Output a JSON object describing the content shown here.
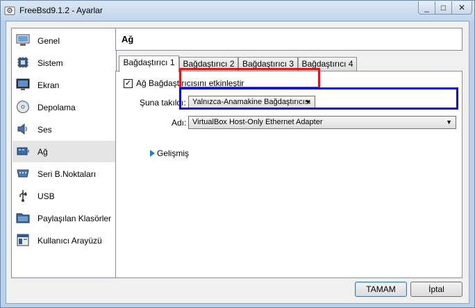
{
  "window": {
    "title": "FreeBsd9.1.2 - Ayarlar",
    "minimize": "_",
    "maximize": "□",
    "close": "✕"
  },
  "sidebar": {
    "items": [
      {
        "label": "Genel",
        "icon": "monitor-icon"
      },
      {
        "label": "Sistem",
        "icon": "chip-icon"
      },
      {
        "label": "Ekran",
        "icon": "display-icon"
      },
      {
        "label": "Depolama",
        "icon": "disk-icon"
      },
      {
        "label": "Ses",
        "icon": "speaker-icon"
      },
      {
        "label": "Ağ",
        "icon": "network-icon",
        "selected": true
      },
      {
        "label": "Seri B.Noktaları",
        "icon": "serial-port-icon"
      },
      {
        "label": "USB",
        "icon": "usb-icon"
      },
      {
        "label": "Paylaşılan Klasörler",
        "icon": "shared-folder-icon"
      },
      {
        "label": "Kullanıcı Arayüzü",
        "icon": "user-interface-icon"
      }
    ]
  },
  "header": {
    "title": "Ağ"
  },
  "tabs": [
    {
      "label": "Bağdaştırıcı 1",
      "active": true
    },
    {
      "label": "Bağdaştırıcı 2"
    },
    {
      "label": "Bağdaştırıcı 3"
    },
    {
      "label": "Bağdaştırıcı 4"
    }
  ],
  "adapter": {
    "enable_label": "Ağ Bağdaştırıcısını etkinleştir",
    "enable_checked": true,
    "check_glyph": "✓",
    "attached_label": "Şuna takıldı:",
    "attached_value": "Yalnızca-Anamakine Bağdaştırıcısı",
    "name_label": "Adı:",
    "name_value": "VirtualBox Host-Only Ethernet Adapter",
    "advanced_label": "Gelişmiş",
    "dropdown_arrow": "▼"
  },
  "buttons": {
    "ok": "TAMAM",
    "cancel": "İptal"
  },
  "colors": {
    "highlight_red": "#e0141b",
    "highlight_blue": "#0d0bd4",
    "selected_item": "#e5e5e5"
  }
}
